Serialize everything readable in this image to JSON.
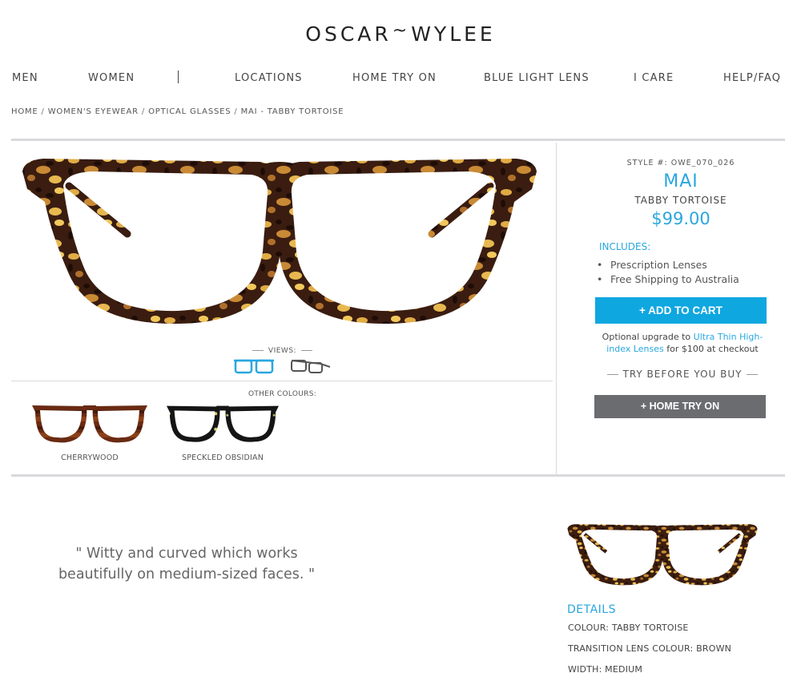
{
  "brand": {
    "left": "OSCAR",
    "mark": "~",
    "right": "WYLEE"
  },
  "nav": [
    {
      "label": "MEN"
    },
    {
      "label": "WOMEN"
    },
    {
      "label": "LOCATIONS"
    },
    {
      "label": "HOME TRY ON"
    },
    {
      "label": "BLUE LIGHT LENS"
    },
    {
      "label": "I CARE"
    },
    {
      "label": "HELP/FAQ"
    }
  ],
  "breadcrumb": [
    "HOME",
    "WOMEN'S EYEWEAR",
    "OPTICAL GLASSES",
    "MAI - TABBY TORTOISE"
  ],
  "gallery": {
    "views_label": "VIEWS:",
    "other_colours_label": "OTHER COLOURS:",
    "variants": [
      {
        "name": "CHERRYWOOD"
      },
      {
        "name": "SPECKLED OBSIDIAN"
      }
    ]
  },
  "product": {
    "style_number": "STYLE #: OWE_070_026",
    "name": "MAI",
    "colour": "TABBY TORTOISE",
    "price": "$99.00",
    "includes_label": "INCLUDES:",
    "includes": [
      "Prescription Lenses",
      "Free Shipping to Australia"
    ],
    "add_to_cart": "+ ADD TO CART",
    "upgrade_prefix": "Optional upgrade to ",
    "upgrade_link": "Ultra Thin High-index Lenses",
    "upgrade_suffix": " for $100 at checkout",
    "try_before": "TRY BEFORE YOU BUY",
    "home_try_on": "+ HOME TRY ON"
  },
  "quote": "\" Witty and curved which works beautifully on medium-sized faces. \"",
  "details": {
    "title": "DETAILS",
    "items": [
      "COLOUR: TABBY TORTOISE",
      "TRANSITION LENS COLOUR: BROWN",
      "WIDTH: MEDIUM"
    ]
  },
  "colors": {
    "accent": "#29a7df",
    "cart_button": "#0fa7e0",
    "try_button": "#6b6c6f",
    "tortoise_dark": "#3a1d10",
    "tortoise_light": "#e6b34a"
  }
}
